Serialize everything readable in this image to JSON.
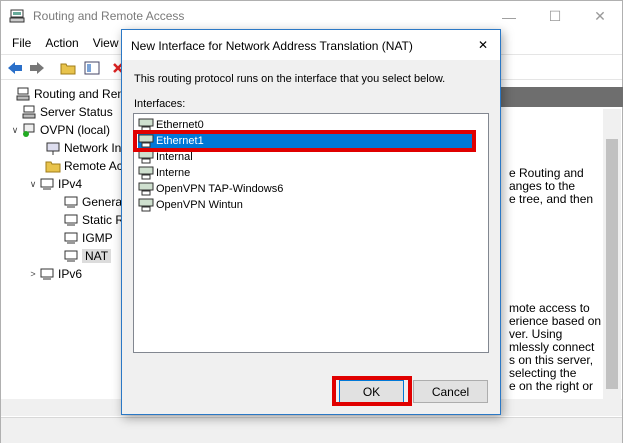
{
  "window": {
    "title": "Routing and Remote Access",
    "minimize": "—",
    "maximize": "☐",
    "close": "✕"
  },
  "menu": [
    "File",
    "Action",
    "View"
  ],
  "tree": {
    "items": [
      {
        "label": "Routing and Remo",
        "toggle": ""
      },
      {
        "label": "Server Status",
        "toggle": ""
      },
      {
        "label": "OVPN (local)",
        "toggle": "∨"
      },
      {
        "label": "Network In",
        "toggle": ""
      },
      {
        "label": "Remote Acc",
        "toggle": ""
      },
      {
        "label": "IPv4",
        "toggle": "∨"
      },
      {
        "label": "Genera",
        "toggle": ""
      },
      {
        "label": "Static R",
        "toggle": ""
      },
      {
        "label": "IGMP",
        "toggle": ""
      },
      {
        "label": "NAT",
        "toggle": ""
      },
      {
        "label": "IPv6",
        "toggle": ">"
      }
    ]
  },
  "right_pane": {
    "lines_top": [
      "e Routing and",
      "anges to the",
      "e tree, and then"
    ],
    "lines_bottom": [
      "mote access to",
      "erience based on",
      "ver. Using",
      "mlessly connect",
      "s on this server,",
      "selecting the",
      "e on the right or"
    ]
  },
  "dialog": {
    "title": "New Interface for Network Address Translation (NAT)",
    "close": "✕",
    "description": "This routing protocol runs on the interface that you select below.",
    "list_label": "Interfaces:",
    "interfaces": [
      "Ethernet0",
      "Ethernet1",
      "Internal",
      "Interne",
      "OpenVPN TAP-Windows6",
      "OpenVPN Wintun"
    ],
    "selected": "Ethernet1",
    "ok_label": "OK",
    "cancel_label": "Cancel"
  },
  "colors": {
    "selection": "#0078d7",
    "annotation": "#e00000",
    "dialog_border": "#2b78c5"
  }
}
